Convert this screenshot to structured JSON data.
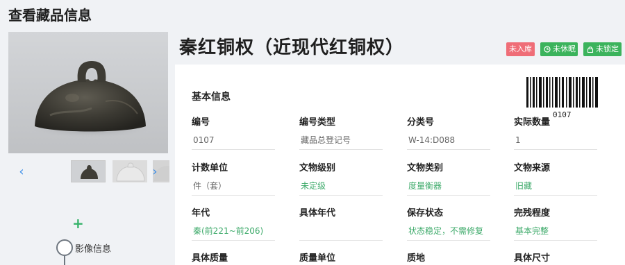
{
  "page": {
    "title": "查看藏品信息"
  },
  "gallery": {
    "prev_icon": "chevron-left-icon",
    "next_icon": "chevron-right-icon",
    "add_icon": "plus-icon",
    "image_section_label": "影像信息"
  },
  "object": {
    "name": "秦红铜权（近现代红铜权）",
    "badges": [
      {
        "label": "未入库",
        "color": "#ef6d77"
      },
      {
        "label": "未休眠",
        "color": "#3bb35c",
        "icon": "clock-icon"
      },
      {
        "label": "未锁定",
        "color": "#3bb35c",
        "icon": "lock-icon"
      }
    ],
    "barcode_number": "0107"
  },
  "basic_info": {
    "section_title": "基本信息",
    "rows": [
      [
        {
          "label": "编号",
          "value": "0107",
          "style": "gray"
        },
        {
          "label": "编号类型",
          "value": "藏品总登记号",
          "style": "gray"
        },
        {
          "label": "分类号",
          "value": "W-14:D088",
          "style": "gray"
        },
        {
          "label": "实际数量",
          "value": "1",
          "style": "gray"
        }
      ],
      [
        {
          "label": "计数单位",
          "value": "件（套）",
          "style": "gray"
        },
        {
          "label": "文物级别",
          "value": "未定级",
          "style": "green"
        },
        {
          "label": "文物类别",
          "value": "度量衡器",
          "style": "green"
        },
        {
          "label": "文物来源",
          "value": "旧藏",
          "style": "green"
        }
      ],
      [
        {
          "label": "年代",
          "value": "秦(前221~前206)",
          "style": "green"
        },
        {
          "label": "具体年代",
          "value": "",
          "style": "gray"
        },
        {
          "label": "保存状态",
          "value": "状态稳定，不需修复",
          "style": "green"
        },
        {
          "label": "完残程度",
          "value": "基本完整",
          "style": "green"
        }
      ],
      [
        {
          "label": "具体质量",
          "value": "",
          "style": "gray"
        },
        {
          "label": "质量单位",
          "value": "",
          "style": "gray"
        },
        {
          "label": "质地",
          "value": "",
          "style": "gray"
        },
        {
          "label": "具体尺寸",
          "value": "",
          "style": "gray"
        }
      ]
    ]
  }
}
